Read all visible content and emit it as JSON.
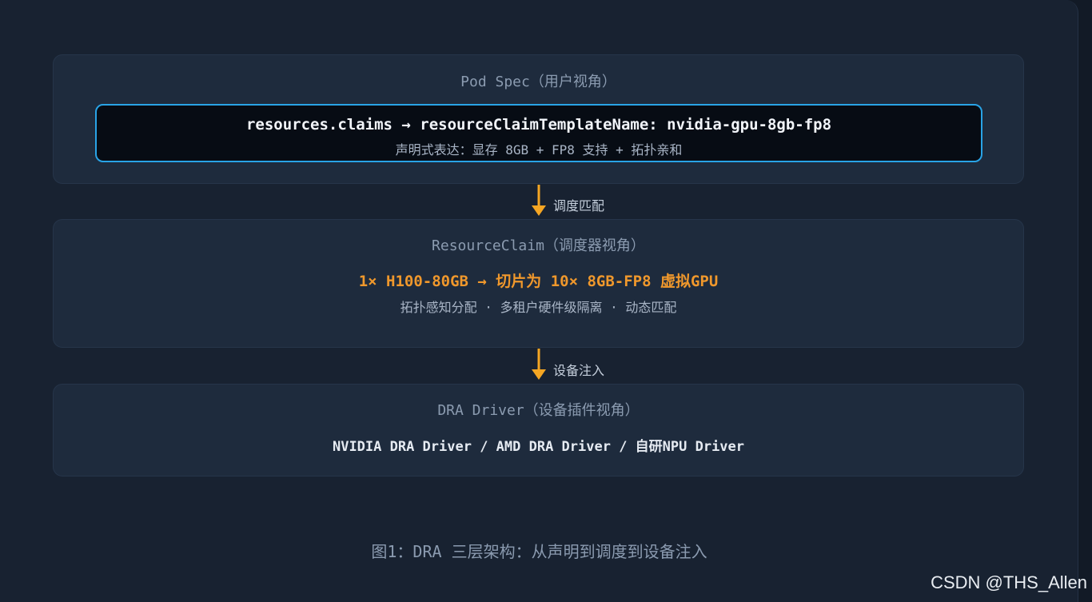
{
  "layers": {
    "pod_spec": {
      "title": "Pod Spec（用户视角）",
      "main": "resources.claims → resourceClaimTemplateName: nvidia-gpu-8gb-fp8",
      "sub": "声明式表达：显存 8GB + FP8 支持 + 拓扑亲和"
    },
    "resource_claim": {
      "title": "ResourceClaim（调度器视角）",
      "main": "1× H100-80GB → 切片为 10× 8GB-FP8 虚拟GPU",
      "sub": "拓扑感知分配 · 多租户硬件级隔离 · 动态匹配"
    },
    "dra_driver": {
      "title": "DRA Driver（设备插件视角）",
      "main": "NVIDIA DRA Driver / AMD DRA Driver / 自研NPU Driver"
    }
  },
  "arrows": [
    {
      "label": "调度匹配"
    },
    {
      "label": "设备注入"
    }
  ],
  "caption": "图1：DRA 三层架构：从声明到调度到设备注入",
  "watermark": "CSDN @THS_Allen",
  "colors": {
    "accent_blue": "#29a3e6",
    "accent_orange": "#f0982c",
    "arrow": "#f5a623"
  }
}
